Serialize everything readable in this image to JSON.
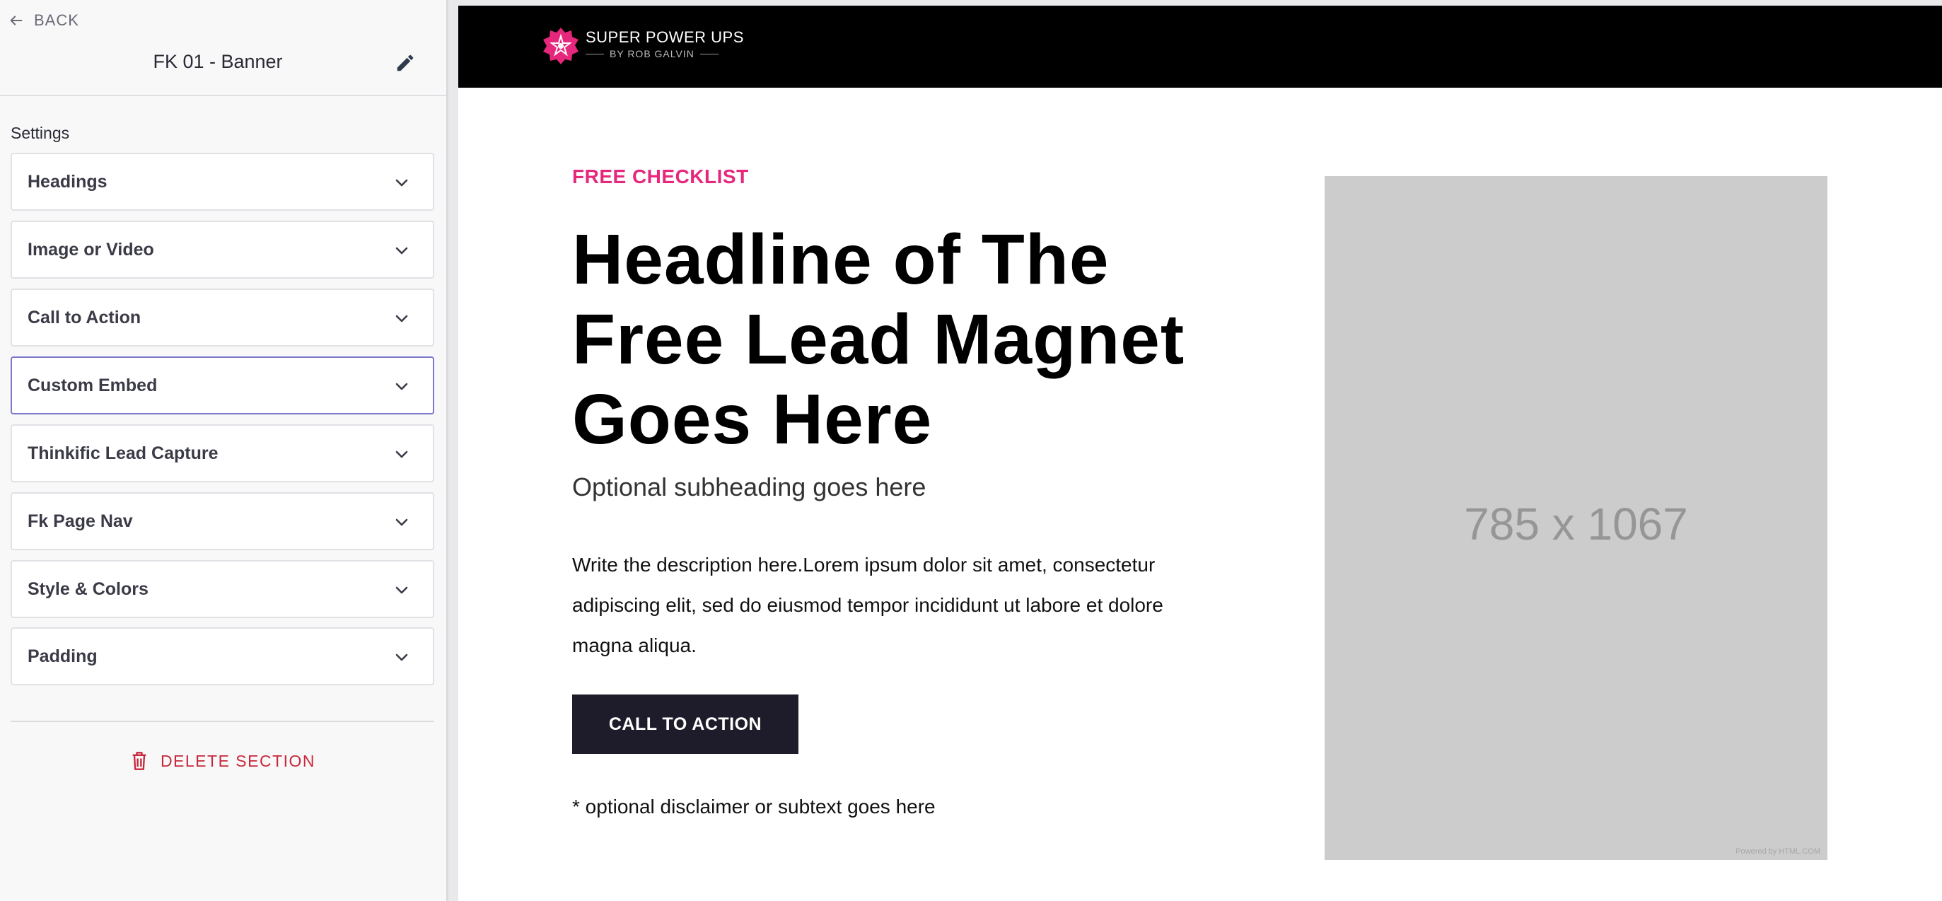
{
  "sidebar": {
    "back_label": "BACK",
    "panel_title": "FK 01 - Banner",
    "settings_label": "Settings",
    "items": [
      {
        "label": "Headings"
      },
      {
        "label": "Image or Video"
      },
      {
        "label": "Call to Action"
      },
      {
        "label": "Custom Embed"
      },
      {
        "label": "Thinkific Lead Capture"
      },
      {
        "label": "Fk Page Nav"
      },
      {
        "label": "Style & Colors"
      },
      {
        "label": "Padding"
      }
    ],
    "delete_label": "DELETE SECTION"
  },
  "preview": {
    "logo": {
      "title": "SUPER POWER UPS",
      "subtitle": "BY ROB GALVIN"
    },
    "eyebrow": "FREE CHECKLIST",
    "headline_lines": [
      "Headline of The",
      "Free Lead Magnet",
      "Goes Here"
    ],
    "subheading": "Optional subheading goes here",
    "description_lines": [
      "Write the description here.Lorem ipsum dolor sit amet, consectetur",
      "adipiscing elit, sed do eiusmod tempor incididunt ut labore et dolore",
      "magna aliqua."
    ],
    "cta_label": "CALL TO ACTION",
    "disclaimer": "* optional disclaimer or subtext goes here",
    "image_placeholder": {
      "dimensions": "785 x 1067",
      "powered_by": "Powered by HTML.COM"
    }
  },
  "colors": {
    "accent_pink": "#e6287d",
    "cta_bg": "#1e1c2b",
    "delete_red": "#c8283b",
    "active_border": "#7c79c9",
    "placeholder_gray": "#cccccc"
  },
  "icons": [
    "arrow-left-icon",
    "pencil-icon",
    "chevron-down-icon",
    "trash-icon",
    "logo-star-icon"
  ]
}
